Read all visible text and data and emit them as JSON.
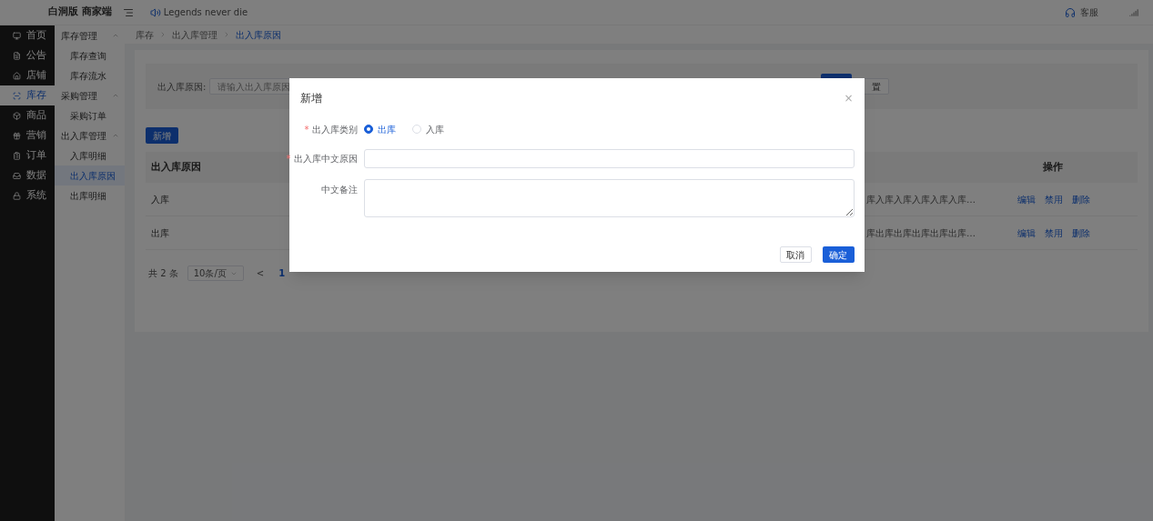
{
  "topbar": {
    "brand": "白洞版 商家端",
    "notice": "Legends never die",
    "support": "客服"
  },
  "nav": [
    {
      "label": "首页",
      "selected": false
    },
    {
      "label": "公告",
      "selected": false
    },
    {
      "label": "店铺",
      "selected": false
    },
    {
      "label": "库存",
      "selected": true
    },
    {
      "label": "商品",
      "selected": false
    },
    {
      "label": "营销",
      "selected": false
    },
    {
      "label": "订单",
      "selected": false
    },
    {
      "label": "数据",
      "selected": false
    },
    {
      "label": "系统",
      "selected": false
    }
  ],
  "subnav": [
    {
      "label": "库存管理",
      "expanded": true,
      "children": [
        {
          "label": "库存查询",
          "selected": false
        },
        {
          "label": "库存流水",
          "selected": false
        }
      ]
    },
    {
      "label": "采购管理",
      "expanded": true,
      "children": [
        {
          "label": "采购订单",
          "selected": false
        }
      ]
    },
    {
      "label": "出入库管理",
      "expanded": true,
      "children": [
        {
          "label": "入库明细",
          "selected": false
        },
        {
          "label": "出入库原因",
          "selected": true
        },
        {
          "label": "出库明细",
          "selected": false
        }
      ]
    }
  ],
  "breadcrumb": [
    "库存",
    "出入库管理",
    "出入库原因"
  ],
  "filter": {
    "label": "出入库原因:",
    "placeholder": "请输入出入库原因",
    "reset_button": "置"
  },
  "add_button": "新增",
  "table": {
    "columns": [
      "出入库原因",
      "操作"
    ],
    "rows": [
      {
        "cells": [
          "入库",
          "库入库入库入库入库入库…"
        ],
        "actions": [
          "编辑",
          "禁用",
          "删除"
        ]
      },
      {
        "cells": [
          "出库",
          "库出库出库出库出库出库…"
        ],
        "actions": [
          "编辑",
          "禁用",
          "删除"
        ]
      }
    ]
  },
  "pagination": {
    "total": "共 2 条",
    "page_size": "10条/页",
    "prev": "<",
    "pages": [
      {
        "label": "1",
        "selected": true
      }
    ]
  },
  "dialog": {
    "title": "新增",
    "close": "×",
    "required_mark": "*",
    "fields": [
      {
        "kind": "radio",
        "label": "出入库类别",
        "required": true,
        "options": [
          {
            "label": "出库",
            "selected": true
          },
          {
            "label": "入库",
            "selected": false
          }
        ]
      },
      {
        "kind": "input",
        "label": "出入库中文原因",
        "required": true
      },
      {
        "kind": "textarea",
        "label": "中文备注",
        "required": false
      }
    ],
    "buttons": [
      {
        "label": "取消",
        "primary": false
      },
      {
        "label": "确定",
        "primary": true
      }
    ]
  }
}
